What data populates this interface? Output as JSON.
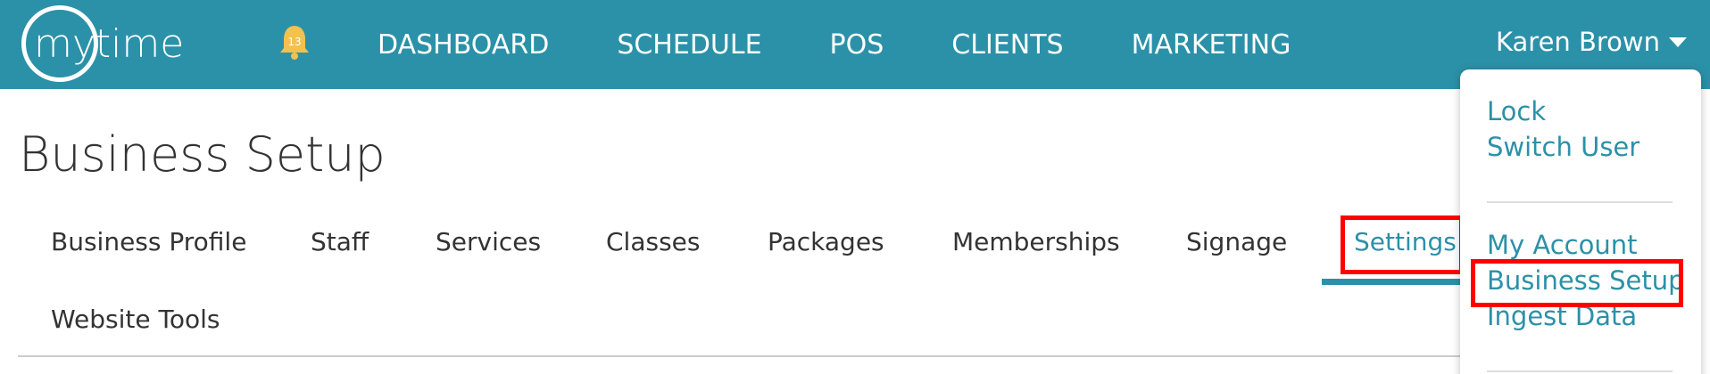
{
  "topbar": {
    "logo_text": "mytime",
    "notification_count": "13",
    "nav": [
      "DASHBOARD",
      "SCHEDULE",
      "POS",
      "CLIENTS",
      "MARKETING"
    ],
    "user_name": "Karen Brown",
    "accent_color": "#2b91a8"
  },
  "page": {
    "title": "Business Setup",
    "tabs": [
      "Business Profile",
      "Staff",
      "Services",
      "Classes",
      "Packages",
      "Memberships",
      "Signage",
      "Settings",
      "Website Tools"
    ],
    "active_tab": "Settings"
  },
  "user_dropdown": {
    "group1": [
      "Lock",
      "Switch User"
    ],
    "group2": [
      "My Account",
      "Business Setup",
      "Ingest Data"
    ]
  },
  "highlights": [
    "Settings",
    "Business Setup"
  ],
  "highlight_color": "#ff0000"
}
